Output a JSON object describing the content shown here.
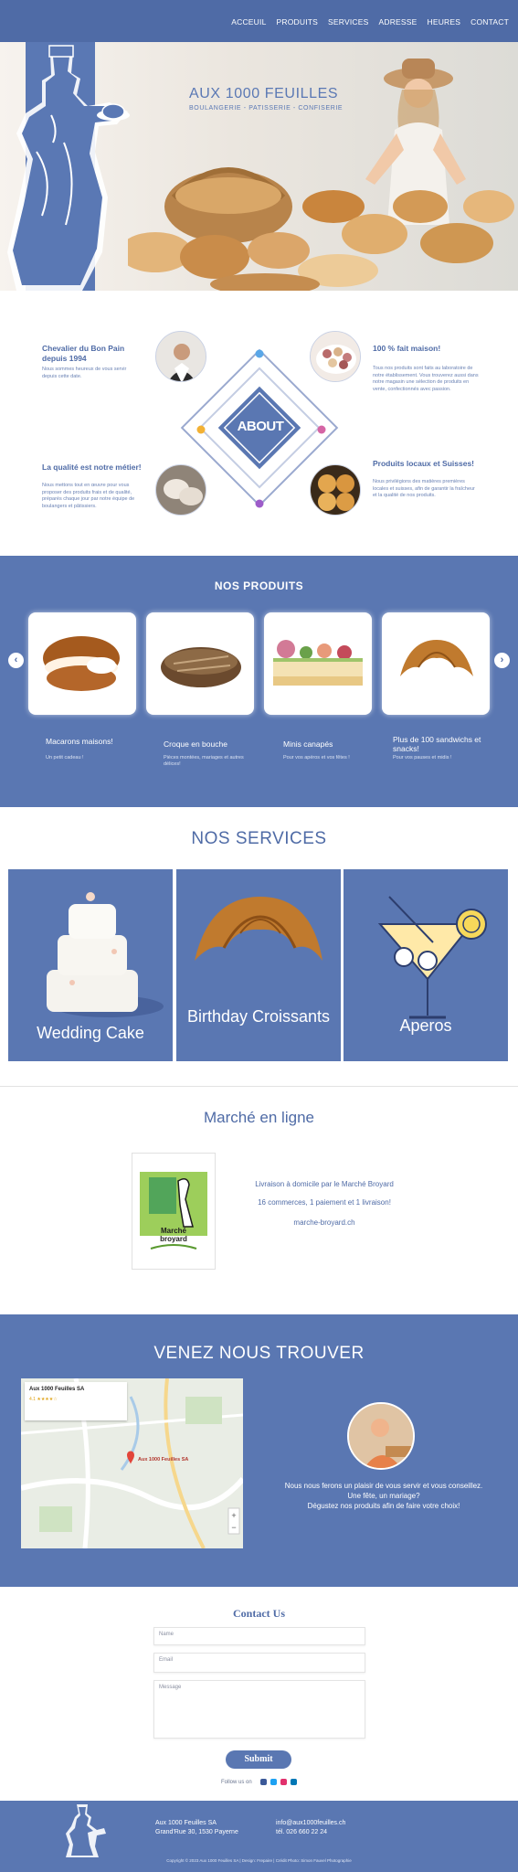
{
  "nav": {
    "items": [
      "ACCEUIL",
      "PRODUITS",
      "SERVICES",
      "ADRESSE",
      "HEURES",
      "CONTACT"
    ]
  },
  "hero": {
    "title": "AUX 1000 FEUILLES",
    "subtitle": "BOULANGERIE - PATISSERIE - CONFISERIE"
  },
  "about": {
    "center_label": "ABOUT",
    "blocks": [
      {
        "title": "Chevalier du Bon Pain depuis 1994",
        "text": "Nous sommes heureux de vous servir depuis cette date."
      },
      {
        "title": "100 % fait maison!",
        "text": "Tous nos produits sont faits au laboratoire de notre établissement. Vous trouverez aussi dans notre magasin une sélection de produits en vente, confectionnés avec passion."
      },
      {
        "title": "La qualité est notre métier!",
        "text": "Nous mettons tout en œuvre pour vous proposer des produits frais et de qualité, préparés chaque jour par notre équipe de boulangers et pâtissiers."
      },
      {
        "title": "Produits locaux et Suisses!",
        "text": "Nous privilégions des matières premières locales et suisses, afin de garantir la fraîcheur et la qualité de nos produits."
      }
    ]
  },
  "products": {
    "title": "NOS PRODUITS",
    "prev": "‹",
    "next": "›",
    "items": [
      {
        "title": "Macarons maisons!",
        "desc": "Un petit cadeau !"
      },
      {
        "title": "Croque en bouche",
        "desc": "Pièces montées, mariages et autres délices!"
      },
      {
        "title": "Minis canapés",
        "desc": "Pour vos apéros et vos fêtes !"
      },
      {
        "title": "Plus de 100 sandwichs et snacks!",
        "desc": "Pour vos pauses et midis !"
      }
    ]
  },
  "services": {
    "title": "NOS SERVICES",
    "items": [
      "Wedding Cake",
      "Birthday Croissants",
      "Aperos"
    ]
  },
  "market": {
    "title": "Marché en ligne",
    "line1": "Livraison à domicile par le Marché Broyard",
    "line2": "16 commerces, 1 paiement et 1 livraison!",
    "link": "marche-broyard.ch",
    "poster_brand_1": "Marché",
    "poster_brand_2": "broyard"
  },
  "find": {
    "title": "VENEZ NOUS TROUVER",
    "map_place": "Aux 1000 Feuilles SA",
    "map_rating": "4.1 ★★★★☆",
    "map_pin_label": "Aux 1000 Feuilles SA",
    "text_line1": "Nous nous ferons un plaisir de vous servir et vous conseillez.",
    "text_line2": "Une fête, un mariage?",
    "text_line3": "Dégustez nos produits afin de faire votre choix!"
  },
  "contact": {
    "title": "Contact Us",
    "name_placeholder": "Name",
    "email_placeholder": "Email",
    "message_placeholder": "Message",
    "submit": "Submit",
    "follow": "Follow us on"
  },
  "footer": {
    "name": "Aux 1000 Feuilles SA",
    "address": "Grand'Rue 30, 1530 Payerne",
    "email": "info@aux1000feuilles.ch",
    "tel": "tél. 026 660 22 24",
    "copyright": "Copyright © 2023 Aux 1000 Feuilles SA | Design: Frepaire | Crédit Photo: Simon Fauvel Photographie"
  },
  "colors": {
    "brand_blue": "#5a77b2",
    "nav_blue": "#4f6ba6",
    "white": "#ffffff"
  }
}
